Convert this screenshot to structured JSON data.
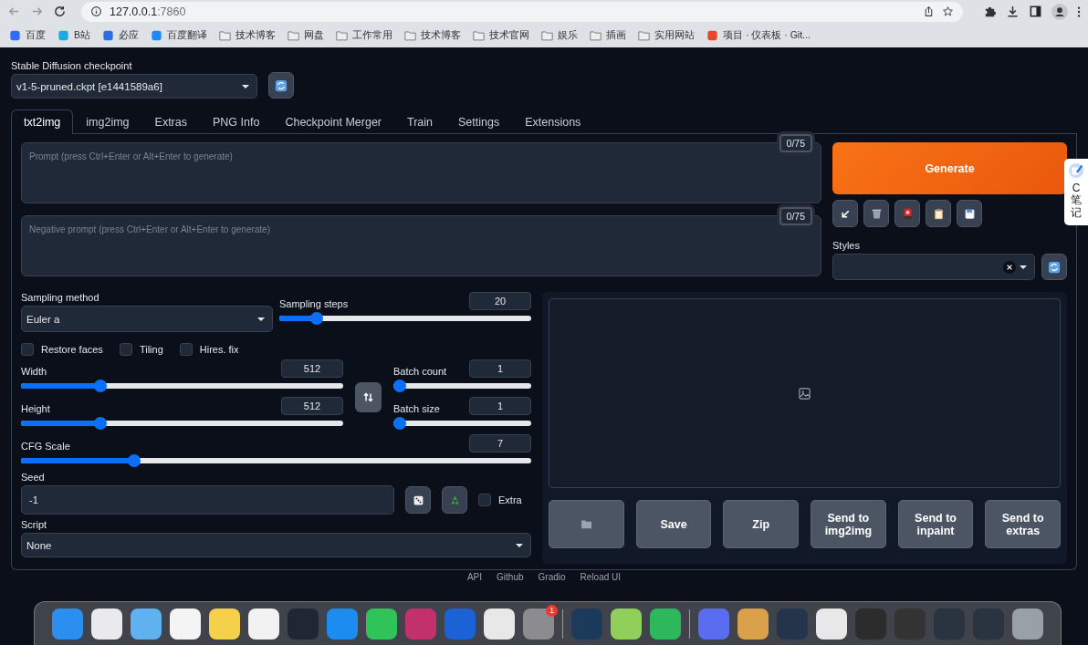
{
  "browser": {
    "url_host": "127.0.0.1",
    "url_port": ":7860",
    "bookmarks": [
      {
        "label": "百度",
        "kind": "site",
        "color": "#2f6df6"
      },
      {
        "label": "B站",
        "kind": "site",
        "color": "#20a8e0"
      },
      {
        "label": "必应",
        "kind": "site",
        "color": "#2a6fdb"
      },
      {
        "label": "百度翻译",
        "kind": "site",
        "color": "#1e88f5"
      },
      {
        "label": "技术博客",
        "kind": "folder"
      },
      {
        "label": "网盘",
        "kind": "folder"
      },
      {
        "label": "工作常用",
        "kind": "folder"
      },
      {
        "label": "技术博客",
        "kind": "folder"
      },
      {
        "label": "技术官网",
        "kind": "folder"
      },
      {
        "label": "娱乐",
        "kind": "folder"
      },
      {
        "label": "插画",
        "kind": "folder"
      },
      {
        "label": "实用网站",
        "kind": "folder"
      },
      {
        "label": "项目 · 仪表板 · Git...",
        "kind": "site",
        "color": "#e2492f"
      }
    ]
  },
  "checkpoint": {
    "label": "Stable Diffusion checkpoint",
    "value": "v1-5-pruned.ckpt [e1441589a6]"
  },
  "tabs": [
    {
      "label": "txt2img",
      "selected": true
    },
    {
      "label": "img2img",
      "selected": false
    },
    {
      "label": "Extras",
      "selected": false
    },
    {
      "label": "PNG Info",
      "selected": false
    },
    {
      "label": "Checkpoint Merger",
      "selected": false
    },
    {
      "label": "Train",
      "selected": false
    },
    {
      "label": "Settings",
      "selected": false
    },
    {
      "label": "Extensions",
      "selected": false
    }
  ],
  "prompt": {
    "placeholder": "Prompt (press Ctrl+Enter or Alt+Enter to generate)",
    "token_count": "0/75"
  },
  "negative_prompt": {
    "placeholder": "Negative prompt (press Ctrl+Enter or Alt+Enter to generate)",
    "token_count": "0/75"
  },
  "generate_button": "Generate",
  "styles": {
    "label": "Styles"
  },
  "sampling_method": {
    "label": "Sampling method",
    "value": "Euler a"
  },
  "sampling_steps": {
    "label": "Sampling steps",
    "value": "20",
    "level": 0.13
  },
  "options": [
    {
      "label": "Restore faces",
      "checked": false
    },
    {
      "label": "Tiling",
      "checked": false
    },
    {
      "label": "Hires. fix",
      "checked": false
    }
  ],
  "width": {
    "label": "Width",
    "value": "512",
    "level": 0.235
  },
  "height": {
    "label": "Height",
    "value": "512",
    "level": 0.235
  },
  "batch_count": {
    "label": "Batch count",
    "value": "1",
    "level": 0
  },
  "batch_size": {
    "label": "Batch size",
    "value": "1",
    "level": 0
  },
  "cfg_scale": {
    "label": "CFG Scale",
    "value": "7",
    "level": 0.214
  },
  "seed": {
    "label": "Seed",
    "value": "-1"
  },
  "extra": {
    "label": "Extra",
    "checked": false
  },
  "script": {
    "label": "Script",
    "value": "None"
  },
  "output_buttons": [
    "Save",
    "Zip",
    "Send to img2img",
    "Send to inpaint",
    "Send to extras"
  ],
  "footer_links": [
    "API",
    "Github",
    "Gradio",
    "Reload UI"
  ],
  "side_widget": {
    "letter": "C",
    "label": "笔记"
  },
  "dock": {
    "badge": "1"
  }
}
